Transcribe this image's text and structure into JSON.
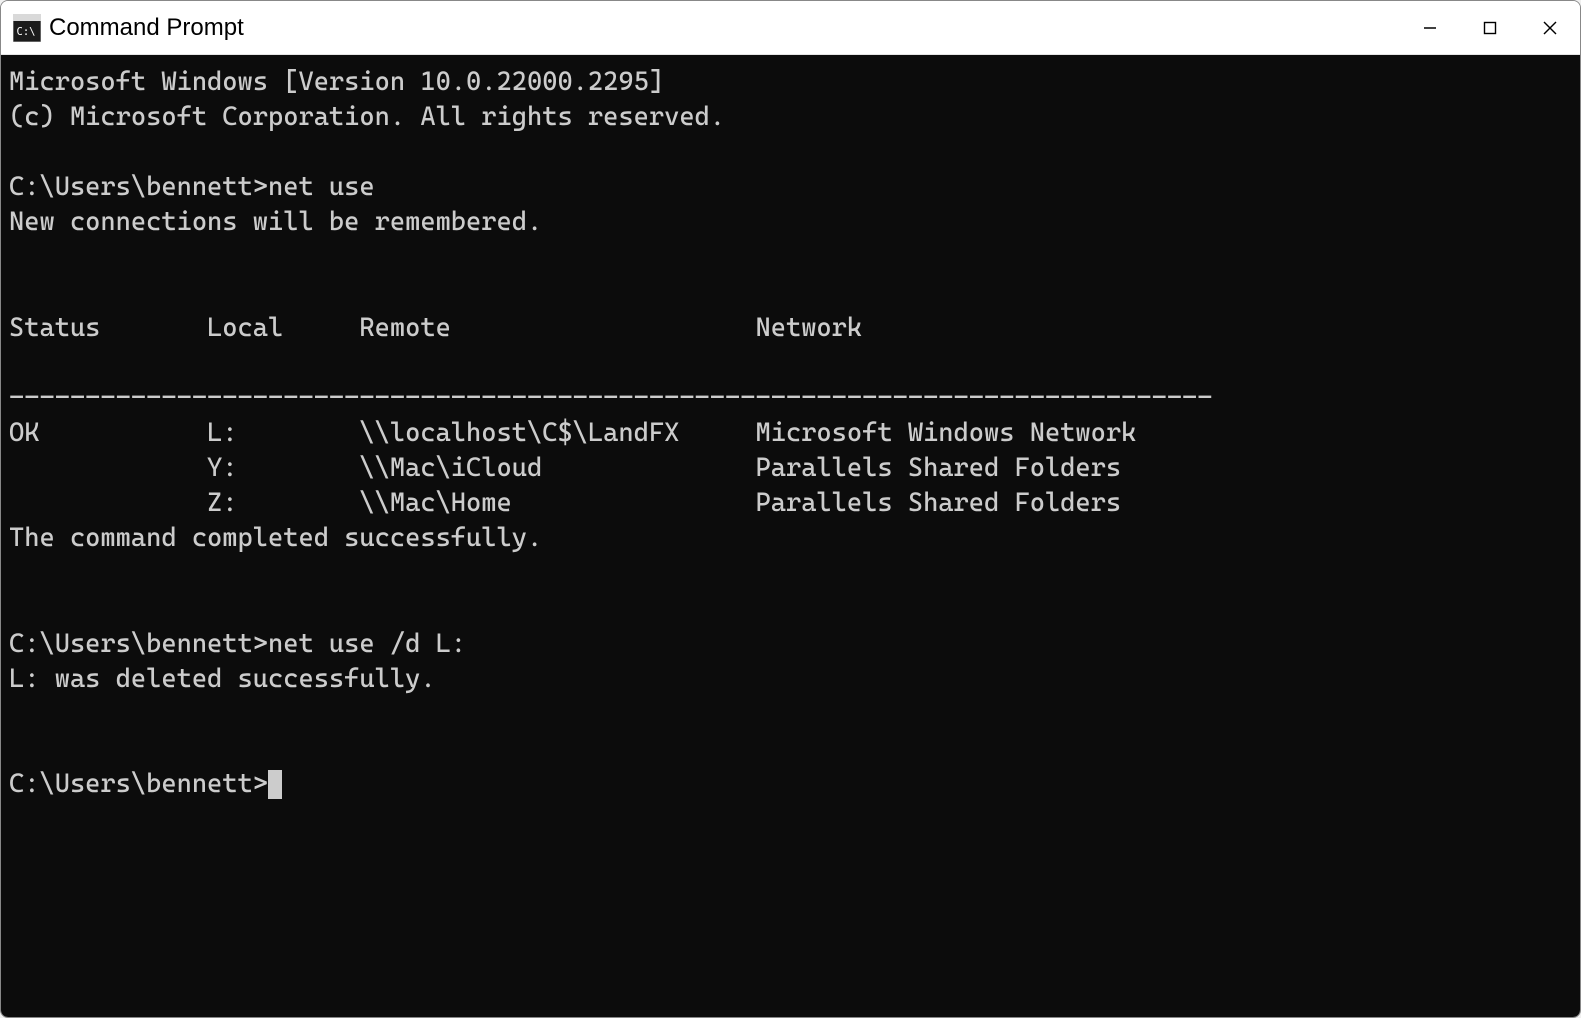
{
  "titlebar": {
    "title": "Command Prompt"
  },
  "terminal": {
    "banner_line1": "Microsoft Windows [Version 10.0.22000.2295]",
    "banner_line2": "(c) Microsoft Corporation. All rights reserved.",
    "prompt": "C:\\Users\\bennett>",
    "cmd1": "net use",
    "netuse_header_msg": "New connections will be remembered.",
    "table_header": "Status       Local     Remote                    Network",
    "table_divider": "-------------------------------------------------------------------------------",
    "rows": [
      {
        "line": "OK           L:        \\\\localhost\\C$\\LandFX     Microsoft Windows Network"
      },
      {
        "line": "             Y:        \\\\Mac\\iCloud              Parallels Shared Folders"
      },
      {
        "line": "             Z:        \\\\Mac\\Home                Parallels Shared Folders"
      }
    ],
    "completed_msg": "The command completed successfully.",
    "cmd2": "net use /d L:",
    "deleted_msg": "L: was deleted successfully."
  }
}
